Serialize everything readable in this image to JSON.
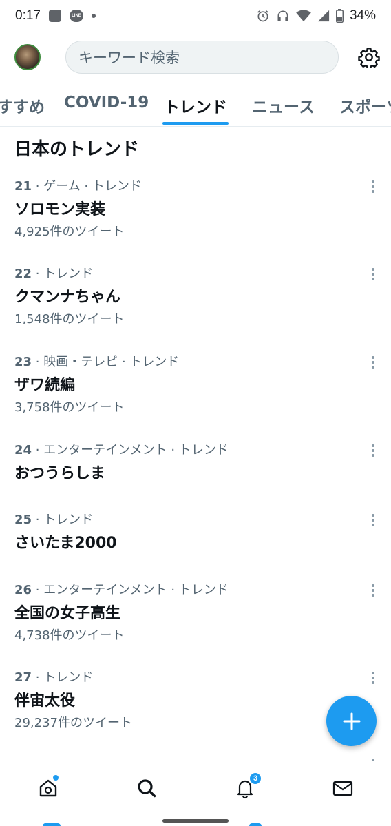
{
  "status_bar": {
    "time": "0:17",
    "line_app_label": "LINE",
    "battery": "34%"
  },
  "header": {
    "search_placeholder": "キーワード検索"
  },
  "tabs": [
    {
      "label": "すすめ",
      "active": false
    },
    {
      "label": "COVID-19",
      "active": false
    },
    {
      "label": "トレンド",
      "active": true
    },
    {
      "label": "ニュース",
      "active": false
    },
    {
      "label": "スポーツ",
      "active": false
    }
  ],
  "section_title": "日本のトレンド",
  "trends": [
    {
      "rank": "21",
      "context": " · ゲーム · トレンド",
      "name": "ソロモン実装",
      "count": "4,925件のツイート"
    },
    {
      "rank": "22",
      "context": " · トレンド",
      "name": "クマンナちゃん",
      "count": "1,548件のツイート"
    },
    {
      "rank": "23",
      "context": " · 映画・テレビ · トレンド",
      "name": "ザワ続編",
      "count": "3,758件のツイート"
    },
    {
      "rank": "24",
      "context": " · エンターテインメント · トレンド",
      "name": "おつうらしま",
      "count": ""
    },
    {
      "rank": "25",
      "context": " · トレンド",
      "name": "さいたま2000",
      "count": ""
    },
    {
      "rank": "26",
      "context": " · エンターテインメント · トレンド",
      "name": "全国の女子高生",
      "count": "4,738件のツイート"
    },
    {
      "rank": "27",
      "context": " · トレンド",
      "name": "伴宙太役",
      "count": "29,237件のツイート"
    }
  ],
  "bottom_nav": {
    "notifications_badge": "3"
  },
  "colors": {
    "accent": "#1d9bf0",
    "text_primary": "#0f1419",
    "text_secondary": "#536471"
  }
}
